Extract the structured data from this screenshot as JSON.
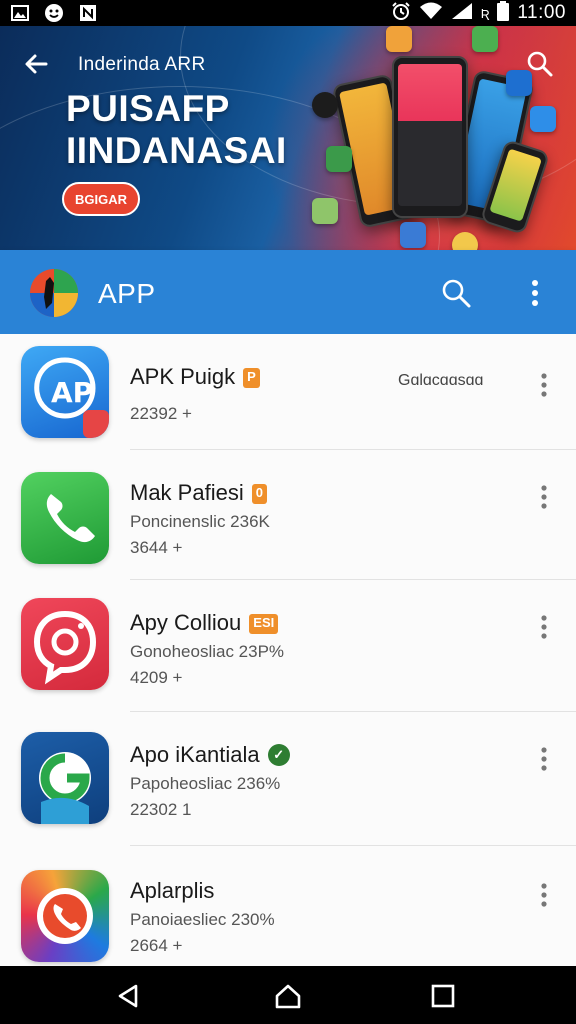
{
  "status_bar": {
    "time": "11:00",
    "network_label": "Ʀ",
    "left_icons": [
      "image-icon",
      "face-icon",
      "notification-icon"
    ],
    "right_icons": [
      "alarm-icon",
      "wifi-icon",
      "signal-icon",
      "battery-icon"
    ]
  },
  "banner": {
    "subtitle": "Inderinda ARR",
    "title_line1": "PUISAFP",
    "title_line2": "IINDANASAI",
    "button_label": "BGIGAR"
  },
  "app_bar": {
    "title": "APP"
  },
  "apps": [
    {
      "name": "APK Puigk",
      "badge": "P",
      "meta": "Gɑlɑcɑɑsɑɑ",
      "description": "",
      "count": "22392 +"
    },
    {
      "name": "Mak Pafiesi",
      "badge": "0",
      "meta": "",
      "description": "Poncinenslic 236K",
      "count": "3644 +"
    },
    {
      "name": "Apy Colliou",
      "badge": "ESI",
      "meta": "",
      "description": "Gonoheosliac 23P%",
      "count": "4209 +"
    },
    {
      "name": "Apo iKantiala",
      "badge": "✓",
      "meta": "",
      "description": "Papoheosliac 236%",
      "count": "22302 1"
    },
    {
      "name": "Aplarplis",
      "badge": "",
      "meta": "",
      "description": "Panoiaesliec 230%",
      "count": "2664 +"
    }
  ],
  "colors": {
    "app_bar": "#2a83d6",
    "badge_orange": "#ef8f2a",
    "badge_green": "#2e7d32"
  }
}
